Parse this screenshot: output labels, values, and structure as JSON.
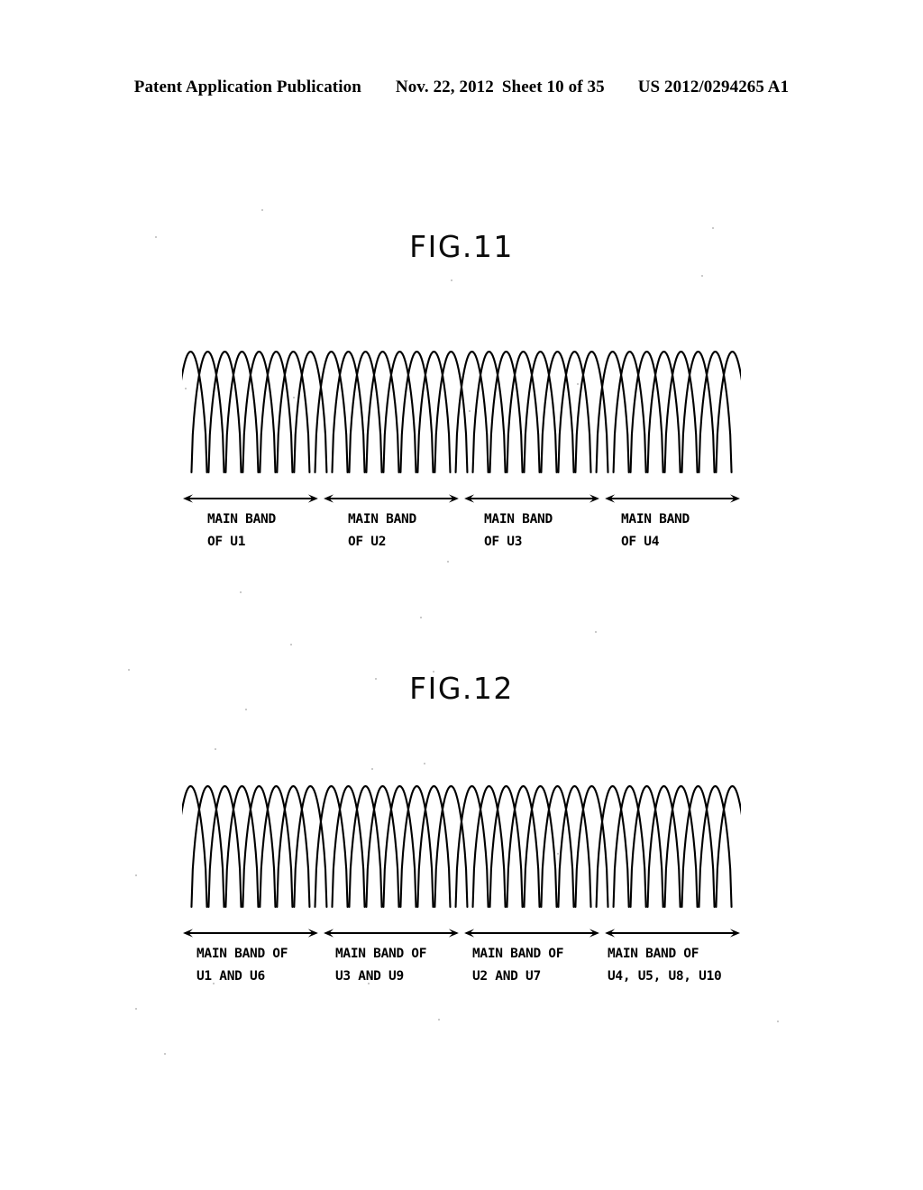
{
  "header": {
    "publication": "Patent Application Publication",
    "date": "Nov. 22, 2012",
    "sheet": "Sheet 10 of 35",
    "patent_number": "US 2012/0294265 A1"
  },
  "figures": [
    {
      "id": "fig11",
      "title": "FIG.11",
      "bands": [
        {
          "line1": "MAIN BAND",
          "line2": "OF U1"
        },
        {
          "line1": "MAIN BAND",
          "line2": "OF U2"
        },
        {
          "line1": "MAIN BAND",
          "line2": "OF U3"
        },
        {
          "line1": "MAIN BAND",
          "line2": "OF U4"
        }
      ]
    },
    {
      "id": "fig12",
      "title": "FIG.12",
      "bands": [
        {
          "line1": "MAIN BAND OF",
          "line2": "U1 AND U6"
        },
        {
          "line1": "MAIN BAND OF",
          "line2": "U3 AND U9"
        },
        {
          "line1": "MAIN BAND OF",
          "line2": "U2 AND U7"
        },
        {
          "line1": "MAIN BAND OF",
          "line2": "U4, U5, U8, U10"
        }
      ]
    }
  ],
  "chart_data": [
    {
      "type": "line",
      "title": "FIG.11",
      "xlabel": "",
      "ylabel": "",
      "description": "Spectrum diagram: four adjacent main bands, each containing 8 overlapping raised-cosine subcarrier lobes of equal amplitude.",
      "groups": 4,
      "lobes_per_group": 8,
      "lobe_amplitude": 1.0,
      "axis_visible": false,
      "grid": false,
      "legend": "none",
      "band_labels": [
        "MAIN BAND OF U1",
        "MAIN BAND OF U2",
        "MAIN BAND OF U3",
        "MAIN BAND OF U4"
      ]
    },
    {
      "type": "line",
      "title": "FIG.12",
      "xlabel": "",
      "ylabel": "",
      "description": "Spectrum diagram: four adjacent main bands, each containing 8 overlapping raised-cosine subcarrier lobes of equal amplitude, shared by multiple users.",
      "groups": 4,
      "lobes_per_group": 8,
      "lobe_amplitude": 1.0,
      "axis_visible": false,
      "grid": false,
      "legend": "none",
      "band_labels": [
        "MAIN BAND OF U1 AND U6",
        "MAIN BAND OF U3 AND U9",
        "MAIN BAND OF U2 AND U7",
        "MAIN BAND OF U4, U5, U8, U10"
      ]
    }
  ],
  "colors": {
    "ink": "#000000",
    "page": "#ffffff"
  }
}
